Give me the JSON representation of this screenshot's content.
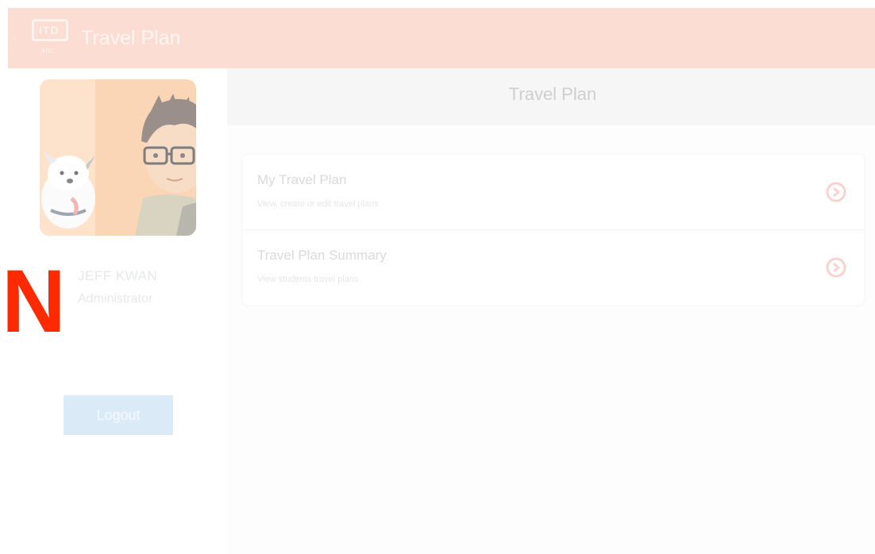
{
  "appbar": {
    "title": "Travel Plan",
    "logo_text": "ITD",
    "logo_sub": "ABC"
  },
  "sidebar": {
    "user_name": "JEFF KWAN",
    "user_role": "Administrator",
    "logout_label": "Logout",
    "overlay_letter": "N"
  },
  "main": {
    "header_title": "Travel Plan",
    "items": [
      {
        "title": "My Travel Plan",
        "subtitle": "View, create or edit travel plans"
      },
      {
        "title": "Travel Plan Summary",
        "subtitle": "View students travel plans"
      }
    ]
  },
  "colors": {
    "appbar": "#fbddd3",
    "logout": "#dbeaf7",
    "accent_icon": "#f8c7c2",
    "overlay_letter": "#ff2a00"
  },
  "icons": {
    "back": "chevron-left-icon",
    "item_arrow": "arrow-circle-right-icon"
  }
}
